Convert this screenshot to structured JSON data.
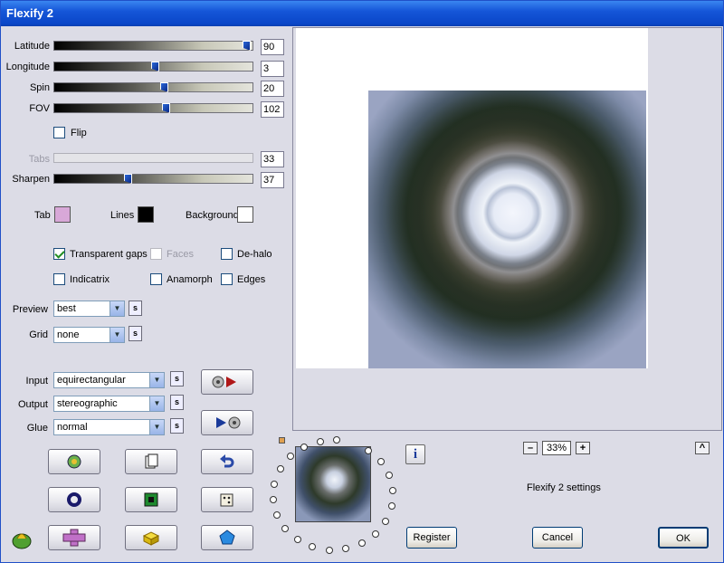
{
  "window": {
    "title": "Flexify 2"
  },
  "sliders": {
    "latitude": {
      "label": "Latitude",
      "value": "90",
      "level": 0.98
    },
    "longitude": {
      "label": "Longitude",
      "value": "3",
      "level": 0.51
    },
    "spin": {
      "label": "Spin",
      "value": "20",
      "level": 0.555
    },
    "fov": {
      "label": "FOV",
      "value": "102",
      "level": 0.565
    },
    "tabs": {
      "label": "Tabs",
      "value": "33",
      "disabled": true
    },
    "sharpen": {
      "label": "Sharpen",
      "value": "37",
      "level": 0.37
    }
  },
  "flip": {
    "label": "Flip",
    "checked": false
  },
  "colors": {
    "tab": {
      "label": "Tab",
      "color": "#d8a8d8"
    },
    "lines": {
      "label": "Lines",
      "color": "#000000"
    },
    "background": {
      "label": "Background",
      "color": "#ffffff"
    }
  },
  "options": {
    "transparent_gaps": {
      "label": "Transparent gaps",
      "checked": true
    },
    "faces": {
      "label": "Faces",
      "checked": false,
      "disabled": true
    },
    "dehalo": {
      "label": "De-halo",
      "checked": false
    },
    "indicatrix": {
      "label": "Indicatrix",
      "checked": false
    },
    "anamorph": {
      "label": "Anamorph",
      "checked": false
    },
    "edges": {
      "label": "Edges",
      "checked": false
    }
  },
  "preview_select": {
    "label": "Preview",
    "value": "best"
  },
  "grid_select": {
    "label": "Grid",
    "value": "none"
  },
  "input_select": {
    "label": "Input",
    "value": "equirectangular"
  },
  "output_select": {
    "label": "Output",
    "value": "stereographic"
  },
  "glue_select": {
    "label": "Glue",
    "value": "normal"
  },
  "s_label": "s",
  "zoom": {
    "minus": "–",
    "value": "33%",
    "plus": "+",
    "up": "^"
  },
  "info_icon": "i",
  "status_text": "Flexify 2 settings",
  "buttons": {
    "register": "Register",
    "cancel": "Cancel",
    "ok": "OK"
  }
}
